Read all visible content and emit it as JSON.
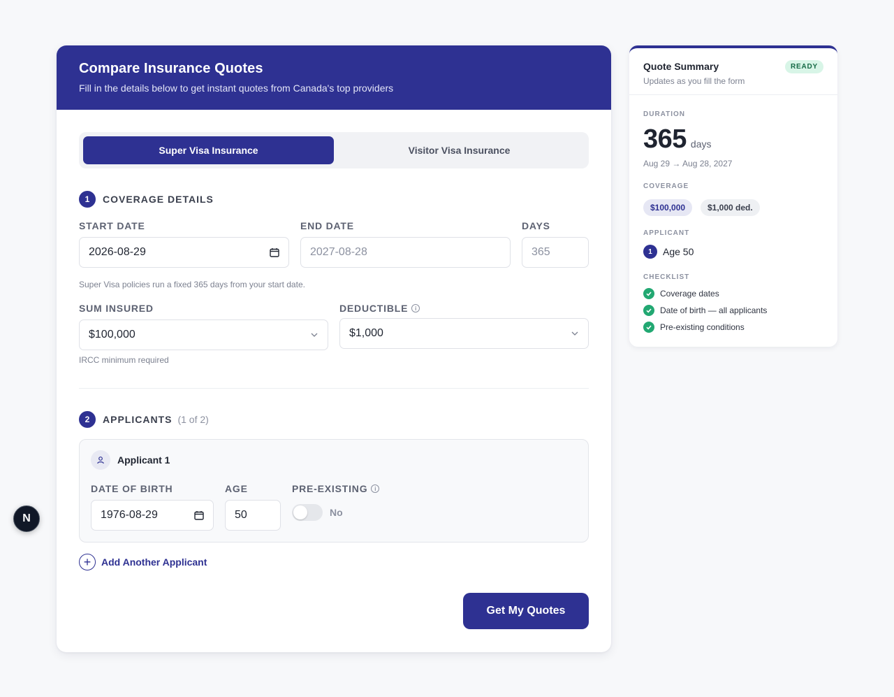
{
  "header": {
    "title": "Compare Insurance Quotes",
    "subtitle": "Fill in the details below to get instant quotes from Canada's top providers"
  },
  "tabs": [
    {
      "label": "Super Visa Insurance",
      "active": true
    },
    {
      "label": "Visitor Visa Insurance",
      "active": false
    }
  ],
  "coverage": {
    "step": "1",
    "title": "COVERAGE DETAILS",
    "start_date_label": "START DATE",
    "start_date_value": "2026-08-29",
    "end_date_label": "END DATE",
    "end_date_value": "2027-08-28",
    "days_label": "DAYS",
    "days_value": "365",
    "helper": "Super Visa policies run a fixed 365 days from your start date.",
    "sum_insured_label": "SUM INSURED",
    "sum_insured_value": "$100,000",
    "sum_insured_helper": "IRCC minimum required",
    "deductible_label": "DEDUCTIBLE",
    "deductible_value": "$1,000"
  },
  "applicants": {
    "step": "2",
    "title": "APPLICANTS",
    "count": "(1 of 2)",
    "items": [
      {
        "name": "Applicant 1",
        "dob_label": "DATE OF BIRTH",
        "dob_value": "1976-08-29",
        "age_label": "AGE",
        "age_value": "50",
        "preexisting_label": "PRE-EXISTING",
        "preexisting_value": "No",
        "preexisting_on": false
      }
    ],
    "add_label": "Add Another Applicant"
  },
  "cta_label": "Get My Quotes",
  "summary": {
    "title": "Quote Summary",
    "subtitle": "Updates as you fill the form",
    "badge": "READY",
    "duration_label": "DURATION",
    "duration_days": "365",
    "duration_unit": "days",
    "date_range": "Aug 29 → Aug 28, 2027",
    "coverage_label": "COVERAGE",
    "coverage_amount": "$100,000",
    "coverage_deductible": "$1,000 ded.",
    "applicant_label": "APPLICANT",
    "applicant_num": "1",
    "applicant_age": "Age 50",
    "checklist_label": "CHECKLIST",
    "checklist": [
      "Coverage dates",
      "Date of birth — all applicants",
      "Pre-existing conditions"
    ]
  },
  "dev_badge": "N",
  "colors": {
    "brand": "#2e3192",
    "success": "#22a872",
    "badge_bg": "#d8f5e7"
  }
}
